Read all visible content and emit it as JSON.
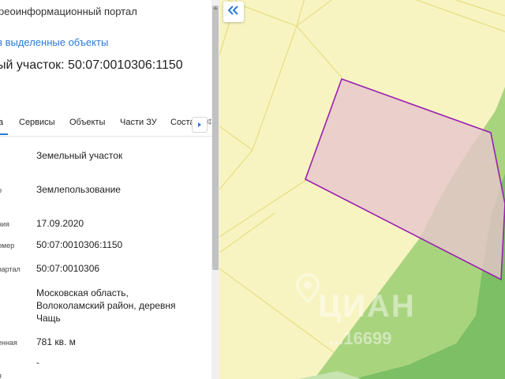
{
  "panel": {
    "portal_title": "реоинформационный портал",
    "selected_link": "з выделенные объекты",
    "parcel_title": "ый участок: 50:07:0010306:1150",
    "tabs": [
      {
        "label": "а",
        "active": true
      },
      {
        "label": "Сервисы"
      },
      {
        "label": "Объекты"
      },
      {
        "label": "Части ЗУ"
      },
      {
        "label": "Соста"
      }
    ],
    "overflow_tab_glyph": "Ф",
    "fields": [
      {
        "label": "",
        "value": "Земельный участок"
      },
      {
        "label": "р",
        "value": "Землепользование"
      },
      {
        "label": "ния",
        "value": "17.09.2020"
      },
      {
        "label": "омер",
        "value": "50:07:0010306:1150"
      },
      {
        "label": "вартал",
        "value": "50:07:0010306"
      },
      {
        "label": "",
        "lines": [
          "Московская область,",
          "Волоколамский район, деревня",
          "Чащь"
        ]
      },
      {
        "label": "енная",
        "value": "781 кв. м"
      },
      {
        "label": "я",
        "value": "-"
      }
    ]
  },
  "map": {
    "watermark_brand": "ЦИАН",
    "watermark_id": "...16699",
    "colors": {
      "background": "#f8f4c2",
      "parcel_lines": "#e8e28c",
      "forest": "#7cbf64",
      "forest_light": "#a9d47e",
      "selected_fill": "#e6c6cc",
      "selected_stroke": "#9a1fb0"
    }
  },
  "icons": {
    "collapse": "double-chevron-left-icon",
    "tab_next": "chevron-right-icon"
  }
}
